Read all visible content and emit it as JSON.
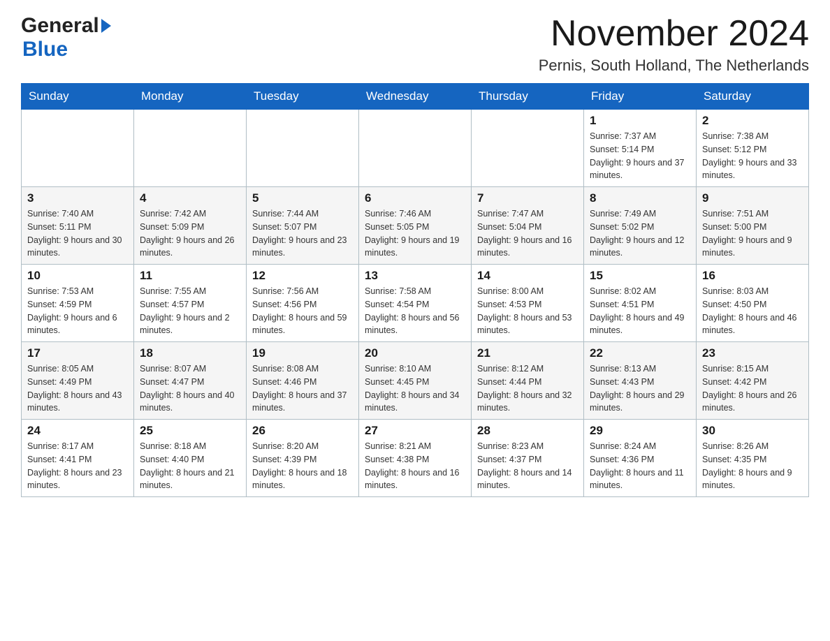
{
  "header": {
    "logo_general": "General",
    "logo_blue": "Blue",
    "month_year": "November 2024",
    "location": "Pernis, South Holland, The Netherlands"
  },
  "weekdays": [
    "Sunday",
    "Monday",
    "Tuesday",
    "Wednesday",
    "Thursday",
    "Friday",
    "Saturday"
  ],
  "weeks": [
    [
      {
        "day": "",
        "sunrise": "",
        "sunset": "",
        "daylight": ""
      },
      {
        "day": "",
        "sunrise": "",
        "sunset": "",
        "daylight": ""
      },
      {
        "day": "",
        "sunrise": "",
        "sunset": "",
        "daylight": ""
      },
      {
        "day": "",
        "sunrise": "",
        "sunset": "",
        "daylight": ""
      },
      {
        "day": "",
        "sunrise": "",
        "sunset": "",
        "daylight": ""
      },
      {
        "day": "1",
        "sunrise": "Sunrise: 7:37 AM",
        "sunset": "Sunset: 5:14 PM",
        "daylight": "Daylight: 9 hours and 37 minutes."
      },
      {
        "day": "2",
        "sunrise": "Sunrise: 7:38 AM",
        "sunset": "Sunset: 5:12 PM",
        "daylight": "Daylight: 9 hours and 33 minutes."
      }
    ],
    [
      {
        "day": "3",
        "sunrise": "Sunrise: 7:40 AM",
        "sunset": "Sunset: 5:11 PM",
        "daylight": "Daylight: 9 hours and 30 minutes."
      },
      {
        "day": "4",
        "sunrise": "Sunrise: 7:42 AM",
        "sunset": "Sunset: 5:09 PM",
        "daylight": "Daylight: 9 hours and 26 minutes."
      },
      {
        "day": "5",
        "sunrise": "Sunrise: 7:44 AM",
        "sunset": "Sunset: 5:07 PM",
        "daylight": "Daylight: 9 hours and 23 minutes."
      },
      {
        "day": "6",
        "sunrise": "Sunrise: 7:46 AM",
        "sunset": "Sunset: 5:05 PM",
        "daylight": "Daylight: 9 hours and 19 minutes."
      },
      {
        "day": "7",
        "sunrise": "Sunrise: 7:47 AM",
        "sunset": "Sunset: 5:04 PM",
        "daylight": "Daylight: 9 hours and 16 minutes."
      },
      {
        "day": "8",
        "sunrise": "Sunrise: 7:49 AM",
        "sunset": "Sunset: 5:02 PM",
        "daylight": "Daylight: 9 hours and 12 minutes."
      },
      {
        "day": "9",
        "sunrise": "Sunrise: 7:51 AM",
        "sunset": "Sunset: 5:00 PM",
        "daylight": "Daylight: 9 hours and 9 minutes."
      }
    ],
    [
      {
        "day": "10",
        "sunrise": "Sunrise: 7:53 AM",
        "sunset": "Sunset: 4:59 PM",
        "daylight": "Daylight: 9 hours and 6 minutes."
      },
      {
        "day": "11",
        "sunrise": "Sunrise: 7:55 AM",
        "sunset": "Sunset: 4:57 PM",
        "daylight": "Daylight: 9 hours and 2 minutes."
      },
      {
        "day": "12",
        "sunrise": "Sunrise: 7:56 AM",
        "sunset": "Sunset: 4:56 PM",
        "daylight": "Daylight: 8 hours and 59 minutes."
      },
      {
        "day": "13",
        "sunrise": "Sunrise: 7:58 AM",
        "sunset": "Sunset: 4:54 PM",
        "daylight": "Daylight: 8 hours and 56 minutes."
      },
      {
        "day": "14",
        "sunrise": "Sunrise: 8:00 AM",
        "sunset": "Sunset: 4:53 PM",
        "daylight": "Daylight: 8 hours and 53 minutes."
      },
      {
        "day": "15",
        "sunrise": "Sunrise: 8:02 AM",
        "sunset": "Sunset: 4:51 PM",
        "daylight": "Daylight: 8 hours and 49 minutes."
      },
      {
        "day": "16",
        "sunrise": "Sunrise: 8:03 AM",
        "sunset": "Sunset: 4:50 PM",
        "daylight": "Daylight: 8 hours and 46 minutes."
      }
    ],
    [
      {
        "day": "17",
        "sunrise": "Sunrise: 8:05 AM",
        "sunset": "Sunset: 4:49 PM",
        "daylight": "Daylight: 8 hours and 43 minutes."
      },
      {
        "day": "18",
        "sunrise": "Sunrise: 8:07 AM",
        "sunset": "Sunset: 4:47 PM",
        "daylight": "Daylight: 8 hours and 40 minutes."
      },
      {
        "day": "19",
        "sunrise": "Sunrise: 8:08 AM",
        "sunset": "Sunset: 4:46 PM",
        "daylight": "Daylight: 8 hours and 37 minutes."
      },
      {
        "day": "20",
        "sunrise": "Sunrise: 8:10 AM",
        "sunset": "Sunset: 4:45 PM",
        "daylight": "Daylight: 8 hours and 34 minutes."
      },
      {
        "day": "21",
        "sunrise": "Sunrise: 8:12 AM",
        "sunset": "Sunset: 4:44 PM",
        "daylight": "Daylight: 8 hours and 32 minutes."
      },
      {
        "day": "22",
        "sunrise": "Sunrise: 8:13 AM",
        "sunset": "Sunset: 4:43 PM",
        "daylight": "Daylight: 8 hours and 29 minutes."
      },
      {
        "day": "23",
        "sunrise": "Sunrise: 8:15 AM",
        "sunset": "Sunset: 4:42 PM",
        "daylight": "Daylight: 8 hours and 26 minutes."
      }
    ],
    [
      {
        "day": "24",
        "sunrise": "Sunrise: 8:17 AM",
        "sunset": "Sunset: 4:41 PM",
        "daylight": "Daylight: 8 hours and 23 minutes."
      },
      {
        "day": "25",
        "sunrise": "Sunrise: 8:18 AM",
        "sunset": "Sunset: 4:40 PM",
        "daylight": "Daylight: 8 hours and 21 minutes."
      },
      {
        "day": "26",
        "sunrise": "Sunrise: 8:20 AM",
        "sunset": "Sunset: 4:39 PM",
        "daylight": "Daylight: 8 hours and 18 minutes."
      },
      {
        "day": "27",
        "sunrise": "Sunrise: 8:21 AM",
        "sunset": "Sunset: 4:38 PM",
        "daylight": "Daylight: 8 hours and 16 minutes."
      },
      {
        "day": "28",
        "sunrise": "Sunrise: 8:23 AM",
        "sunset": "Sunset: 4:37 PM",
        "daylight": "Daylight: 8 hours and 14 minutes."
      },
      {
        "day": "29",
        "sunrise": "Sunrise: 8:24 AM",
        "sunset": "Sunset: 4:36 PM",
        "daylight": "Daylight: 8 hours and 11 minutes."
      },
      {
        "day": "30",
        "sunrise": "Sunrise: 8:26 AM",
        "sunset": "Sunset: 4:35 PM",
        "daylight": "Daylight: 8 hours and 9 minutes."
      }
    ]
  ]
}
